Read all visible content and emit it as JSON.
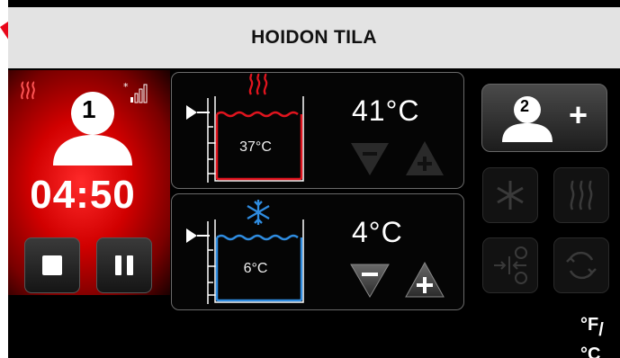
{
  "header": {
    "title": "HOIDON TILA"
  },
  "active_user": {
    "number": "1",
    "timer": "04:50"
  },
  "zones": [
    {
      "id": "hot",
      "current_temp": "37°C",
      "setpoint": "41°C",
      "accent": "#e0141e",
      "minus_enabled": false,
      "plus_enabled": false
    },
    {
      "id": "cold",
      "current_temp": "6°C",
      "setpoint": "4°C",
      "accent": "#2f8ce0",
      "minus_enabled": true,
      "plus_enabled": true
    }
  ],
  "add_user": {
    "number": "2",
    "label": "+"
  },
  "unit_toggle": {
    "f": "°F",
    "slash": "/",
    "c": "°C"
  },
  "colors": {
    "active_red": "#d10000",
    "hot": "#e0141e",
    "cold": "#2f8ce0",
    "title_bg": "#e3e3e3"
  }
}
